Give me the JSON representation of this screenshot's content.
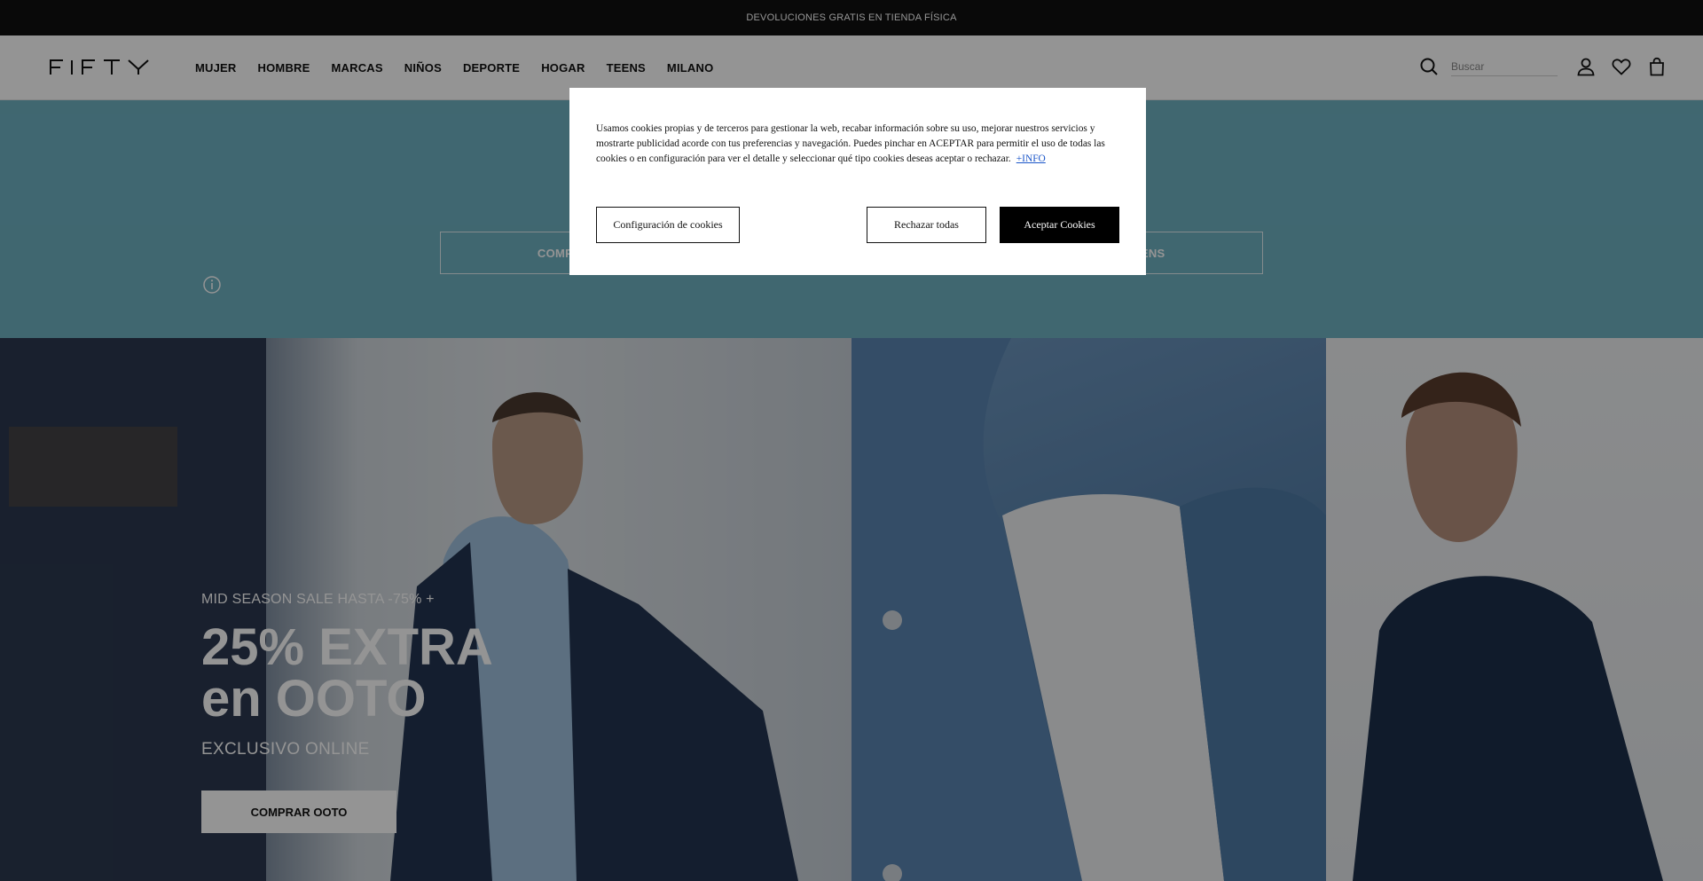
{
  "announcement": "DEVOLUCIONES GRATIS EN TIENDA FÍSICA",
  "brand": {
    "logo_text": "FIFTY"
  },
  "nav": [
    {
      "label": "MUJER"
    },
    {
      "label": "HOMBRE"
    },
    {
      "label": "MARCAS"
    },
    {
      "label": "NIÑOS"
    },
    {
      "label": "DEPORTE"
    },
    {
      "label": "HOGAR"
    },
    {
      "label": "TEENS"
    },
    {
      "label": "MILANO"
    }
  ],
  "search": {
    "placeholder": "Buscar"
  },
  "header_icons": [
    "search-icon",
    "user-icon",
    "heart-icon",
    "bag-icon"
  ],
  "teal_band": {
    "color": "#6fb2c2",
    "buttons": [
      {
        "label": "COMPRAR MUJER"
      },
      {
        "label": "COMPRAR TEENS"
      }
    ]
  },
  "hero": {
    "kicker": "MID SEASON SALE HASTA -75% +",
    "title_line1": "25% EXTRA",
    "title_line2": "en OOTO",
    "subtitle": "EXCLUSIVO ONLINE",
    "cta": "COMPRAR OOTO"
  },
  "cookie_dialog": {
    "text": "Usamos cookies propias y de terceros para gestionar la web, recabar información sobre su uso, mejorar nuestros servicios y mostrarte publicidad acorde con tus preferencias y navegación. Puedes pinchar en ACEPTAR para permitir el uso de todas las cookies o en configuración para ver el detalle y seleccionar qué tipo cookies deseas aceptar o rechazar.",
    "more_link": "+INFO",
    "config_button": "Configuración de cookies",
    "reject_button": "Rechazar todas",
    "accept_button": "Aceptar Cookies"
  }
}
